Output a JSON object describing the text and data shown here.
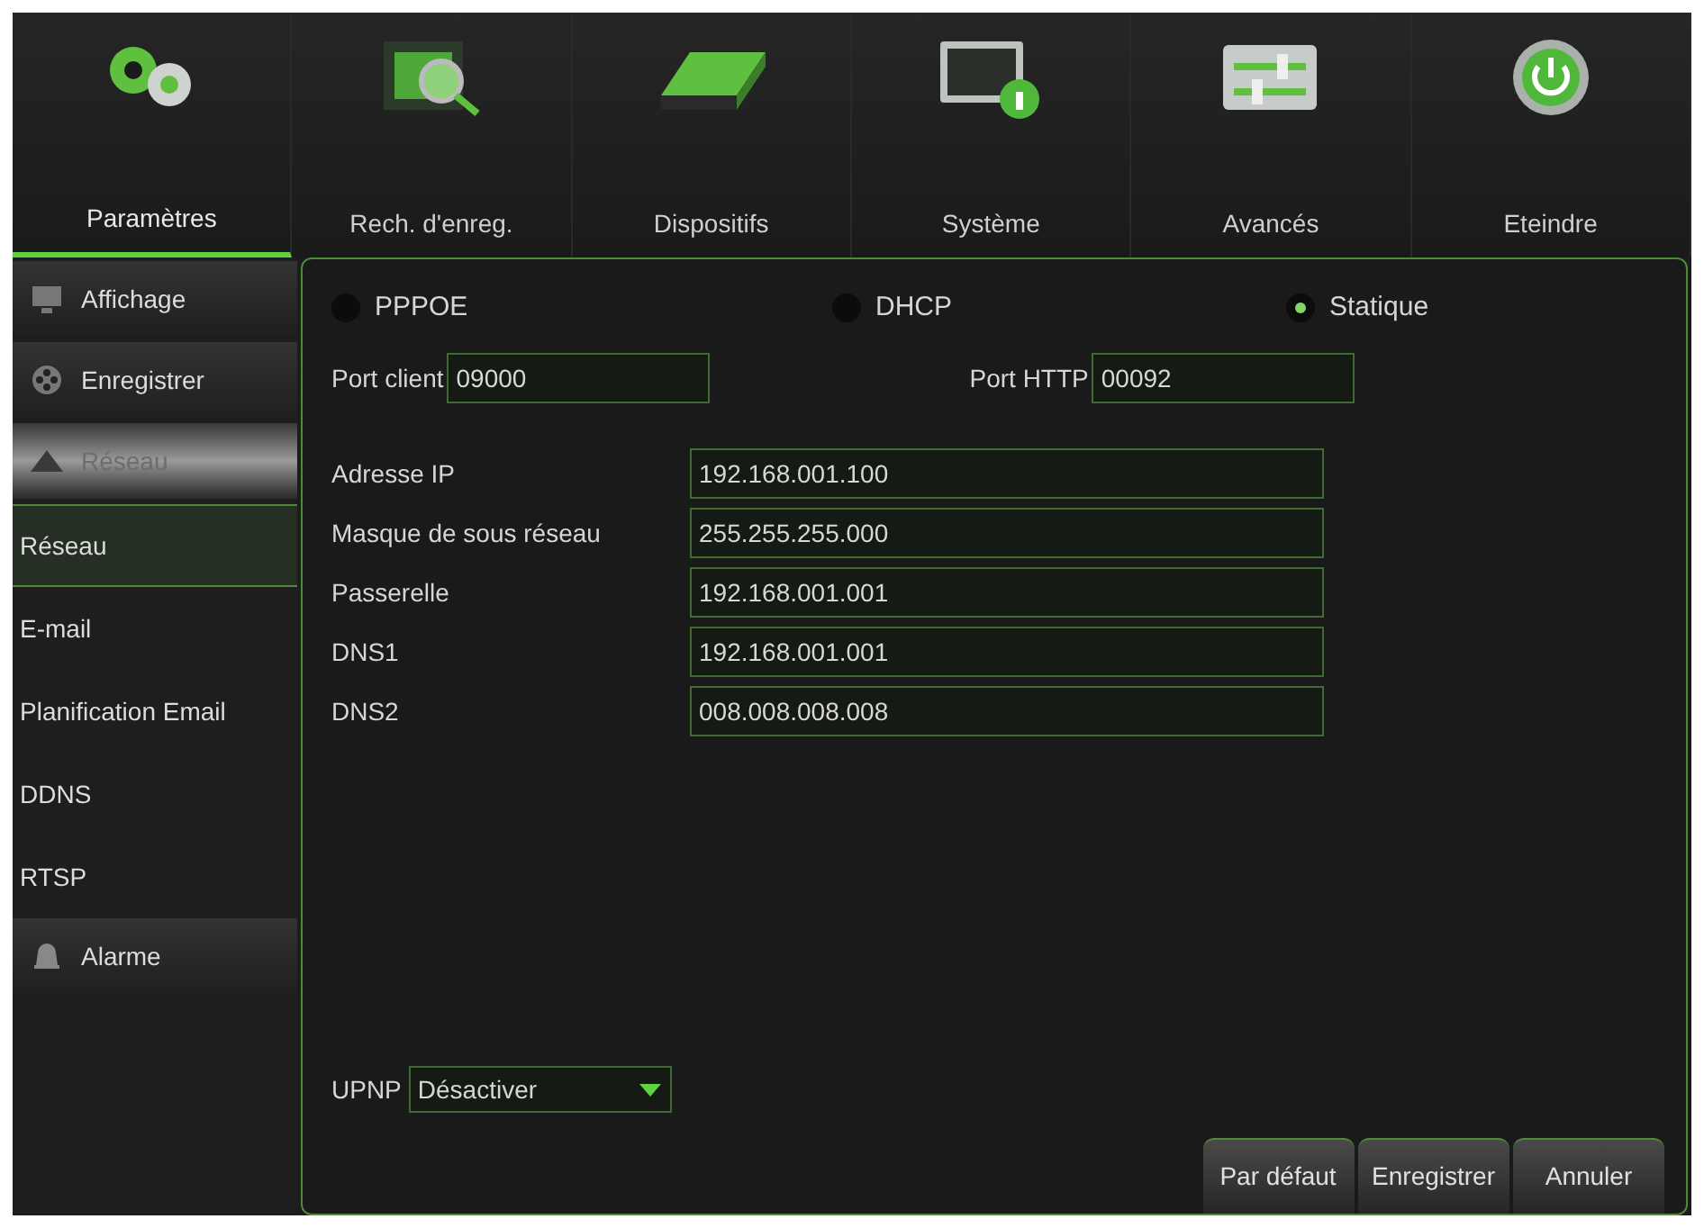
{
  "top_tabs": [
    {
      "label": "Paramètres",
      "kind": "gears",
      "selected": true
    },
    {
      "label": "Rech. d'enreg.",
      "kind": "search",
      "selected": false
    },
    {
      "label": "Dispositifs",
      "kind": "drive",
      "selected": false
    },
    {
      "label": "Système",
      "kind": "info",
      "selected": false
    },
    {
      "label": "Avancés",
      "kind": "sliders",
      "selected": false
    },
    {
      "label": "Eteindre",
      "kind": "power",
      "selected": false
    }
  ],
  "sidebar": {
    "items": [
      {
        "label": "Affichage",
        "kind": "display",
        "expanded": false
      },
      {
        "label": "Enregistrer",
        "kind": "film",
        "expanded": false
      },
      {
        "label": "Réseau",
        "kind": "network",
        "expanded": true,
        "children": [
          {
            "label": "Réseau",
            "selected": true
          },
          {
            "label": "E-mail",
            "selected": false
          },
          {
            "label": "Planification Email",
            "selected": false
          },
          {
            "label": "DDNS",
            "selected": false
          },
          {
            "label": "RTSP",
            "selected": false
          }
        ]
      },
      {
        "label": "Alarme",
        "kind": "alarm",
        "expanded": false
      }
    ]
  },
  "connection_modes": [
    {
      "label": "PPPOE",
      "selected": false
    },
    {
      "label": "DHCP",
      "selected": false
    },
    {
      "label": "Statique",
      "selected": true
    }
  ],
  "ports": [
    {
      "label": "Port client",
      "value": "09000"
    },
    {
      "label": "Port HTTP",
      "value": "00092"
    }
  ],
  "address_fields": [
    {
      "label": "Adresse IP",
      "value": "192.168.001.100"
    },
    {
      "label": "Masque de sous réseau",
      "value": "255.255.255.000"
    },
    {
      "label": "Passerelle",
      "value": "192.168.001.001"
    },
    {
      "label": "DNS1",
      "value": "192.168.001.001"
    },
    {
      "label": "DNS2",
      "value": "008.008.008.008"
    }
  ],
  "upnp": {
    "label": "UPNP",
    "value": "Désactiver"
  },
  "buttons": [
    "Par défaut",
    "Enregistrer",
    "Annuler"
  ]
}
